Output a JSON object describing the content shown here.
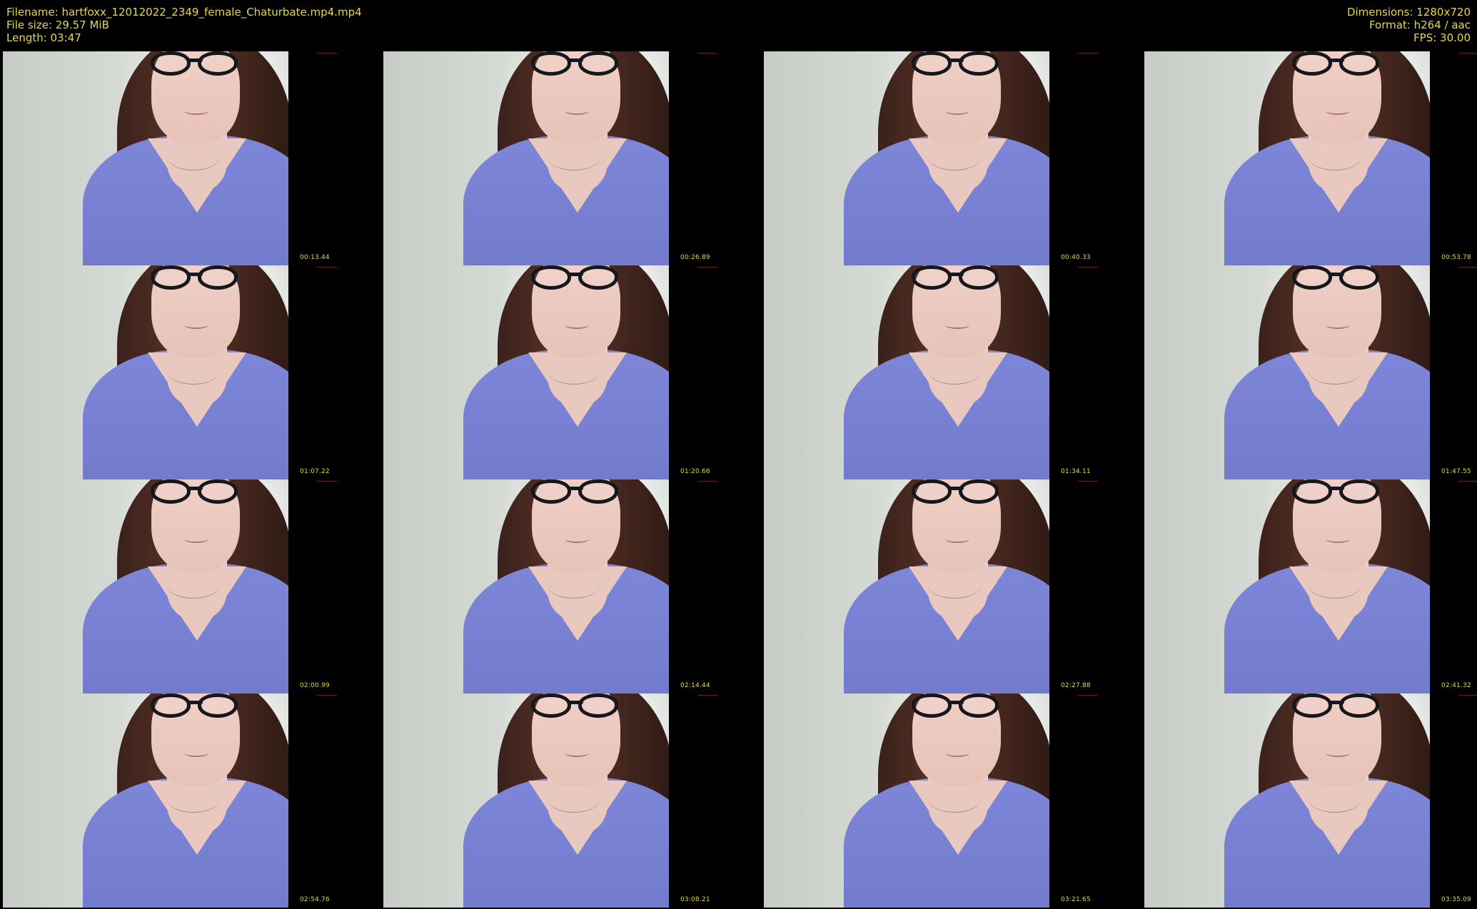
{
  "header": {
    "left": {
      "filename": "Filename: hartfoxx_12012022_2349_female_Chaturbate.mp4.mp4",
      "file_size": "File size: 29.57 MiB",
      "length": "Length: 03:47"
    },
    "right": {
      "dimensions": "Dimensions: 1280x720",
      "format": "Format: h264 / aac",
      "fps": "FPS: 30.00"
    }
  },
  "timestamps": [
    "00:13.44",
    "00:26.89",
    "00:40.33",
    "00:53.78",
    "01:07.22",
    "01:20.66",
    "01:34.11",
    "01:47.55",
    "02:00.99",
    "02:14.44",
    "02:27.88",
    "02:41.32",
    "02:54.76",
    "03:08.21",
    "03:21.65",
    "03:35.09"
  ],
  "colors": {
    "background": "#000000",
    "metadata_text": "#e6d84a"
  }
}
